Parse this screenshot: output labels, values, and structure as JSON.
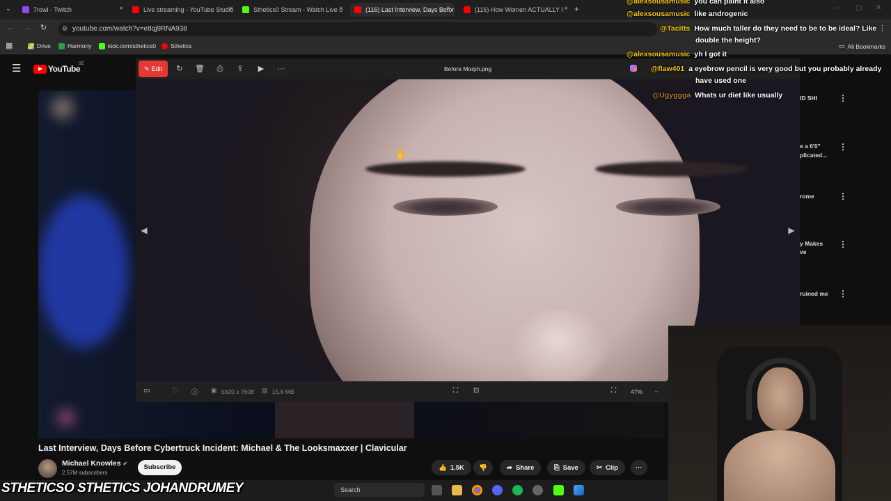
{
  "browser": {
    "tabs": [
      {
        "label": "7rowl - Twitch",
        "color": "#9146ff"
      },
      {
        "label": "Live streaming - YouTube Studio",
        "color": "#ff0000"
      },
      {
        "label": "Sthetics0 Stream - Watch Live o",
        "color": "#53fc18"
      },
      {
        "label": "(116) Last Interview, Days Before",
        "color": "#ff0000"
      },
      {
        "label": "(116) How Women ACTUALLY I",
        "color": "#ff0000"
      }
    ],
    "url": "youtube.com/watch?v=e8qj9RNA938",
    "bookmarks": [
      "Drive",
      "Harmony",
      "kick.com/sthetics0",
      "Sthetics"
    ],
    "all_bookmarks": "All Bookmarks"
  },
  "youtube": {
    "logo_text": "YouTube",
    "region": "SE",
    "video_title": "Last Interview, Days Before Cybertruck Incident: Michael & The Looksmaxxer | Clavicular",
    "channel_name": "Michael Knowles",
    "subscribers": "2.57M subscribers",
    "subscribe_label": "Subscribe",
    "likes": "1.5K",
    "share_label": "Share",
    "save_label": "Save",
    "clip_label": "Clip",
    "more_label": "···",
    "sidebar_fragments": [
      "ID SHI",
      "e a 6'0\"",
      "plicated...",
      "rome",
      "y Makes",
      "ve",
      "ruined me"
    ]
  },
  "viewer": {
    "edit_label": "Edit",
    "file_name": "Before Morph.png",
    "dimensions": "5820 x 7608",
    "file_size": "15.6 MB",
    "zoom": "47%"
  },
  "chat": [
    {
      "user": "@alexsousamusic",
      "msg": "you can paint it also"
    },
    {
      "user": "@alexsousamusic",
      "msg": "like androgenic"
    },
    {
      "user": "@Tacitts",
      "msg": "How much taller do they need to be to be ideal? Like"
    },
    {
      "user": "",
      "msg": "double the height?"
    },
    {
      "user": "@alexsousamusic",
      "msg": "yh I got it"
    },
    {
      "user": "@flaw401",
      "msg": "a eyebrow pencil is very good but you probably already"
    },
    {
      "user": "",
      "msg": "have used one"
    },
    {
      "user": "@Ugyggga",
      "msg": "Whats ur diet like usually"
    }
  ],
  "overlay": {
    "social_banner": "STHETICSO STHETICS JOHANDRUMEY"
  },
  "taskbar": {
    "search_placeholder": "Search"
  }
}
